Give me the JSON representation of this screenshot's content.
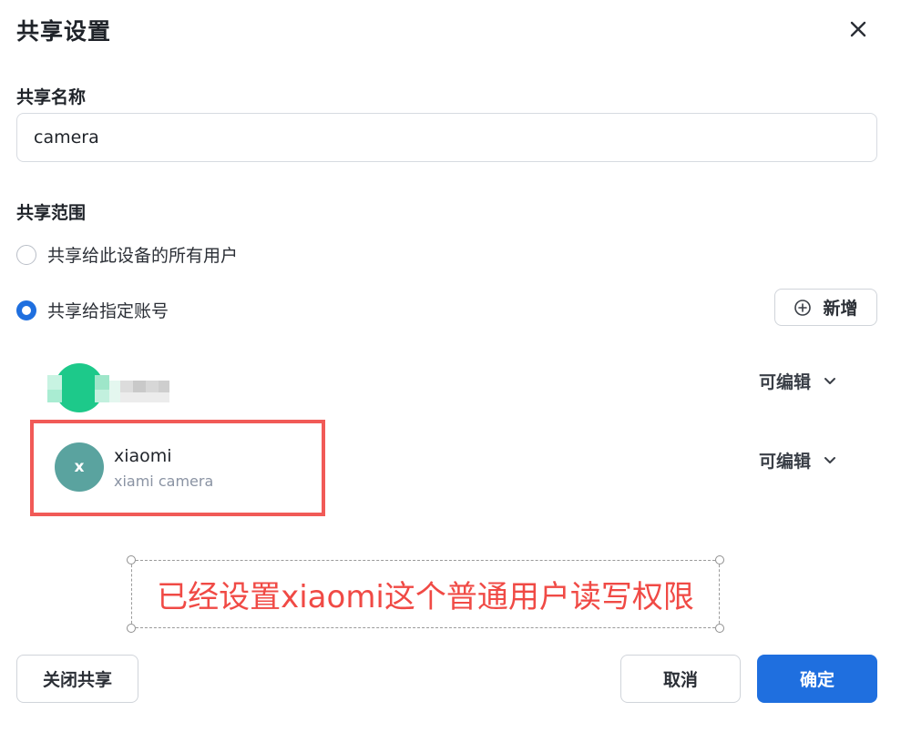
{
  "dialog": {
    "title": "共享设置",
    "close_icon": "close-icon"
  },
  "share_name": {
    "label": "共享名称",
    "value": "camera"
  },
  "share_scope": {
    "label": "共享范围",
    "options": [
      {
        "label": "共享给此设备的所有用户",
        "checked": false
      },
      {
        "label": "共享给指定账号",
        "checked": true
      }
    ],
    "add_button": {
      "label": "新增",
      "icon": "plus-circle-icon"
    }
  },
  "accounts": [
    {
      "name": "",
      "detail": "",
      "avatar_letter": "",
      "avatar_color": "#1dc98a",
      "permission": "可编辑",
      "blurred": true
    },
    {
      "name": "xiaomi",
      "detail": "xiami camera",
      "avatar_letter": "x",
      "avatar_color": "#5aa39f",
      "permission": "可编辑",
      "blurred": false
    }
  ],
  "annotation": {
    "text": "已经设置xiaomi这个普通用户读写权限",
    "color": "#f04a45"
  },
  "footer": {
    "close_share_label": "关闭共享",
    "cancel_label": "取消",
    "confirm_label": "确定"
  },
  "colors": {
    "primary": "#1f6fdf",
    "highlight": "#f15a57"
  }
}
